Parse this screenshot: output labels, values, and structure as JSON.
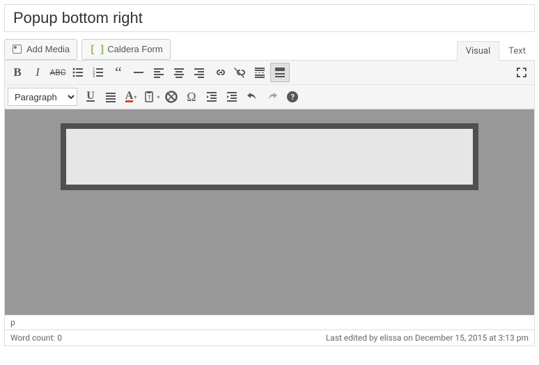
{
  "title": "Popup bottom right",
  "buttons": {
    "add_media": "Add Media",
    "caldera_form": "Caldera Form"
  },
  "tabs": {
    "visual": "Visual",
    "text": "Text"
  },
  "format_select": "Paragraph",
  "path": "p",
  "status": {
    "word_count_label": "Word count: ",
    "word_count": "0",
    "last_edited": "Last edited by elissa on December 15, 2015 at 3:13 pm"
  }
}
